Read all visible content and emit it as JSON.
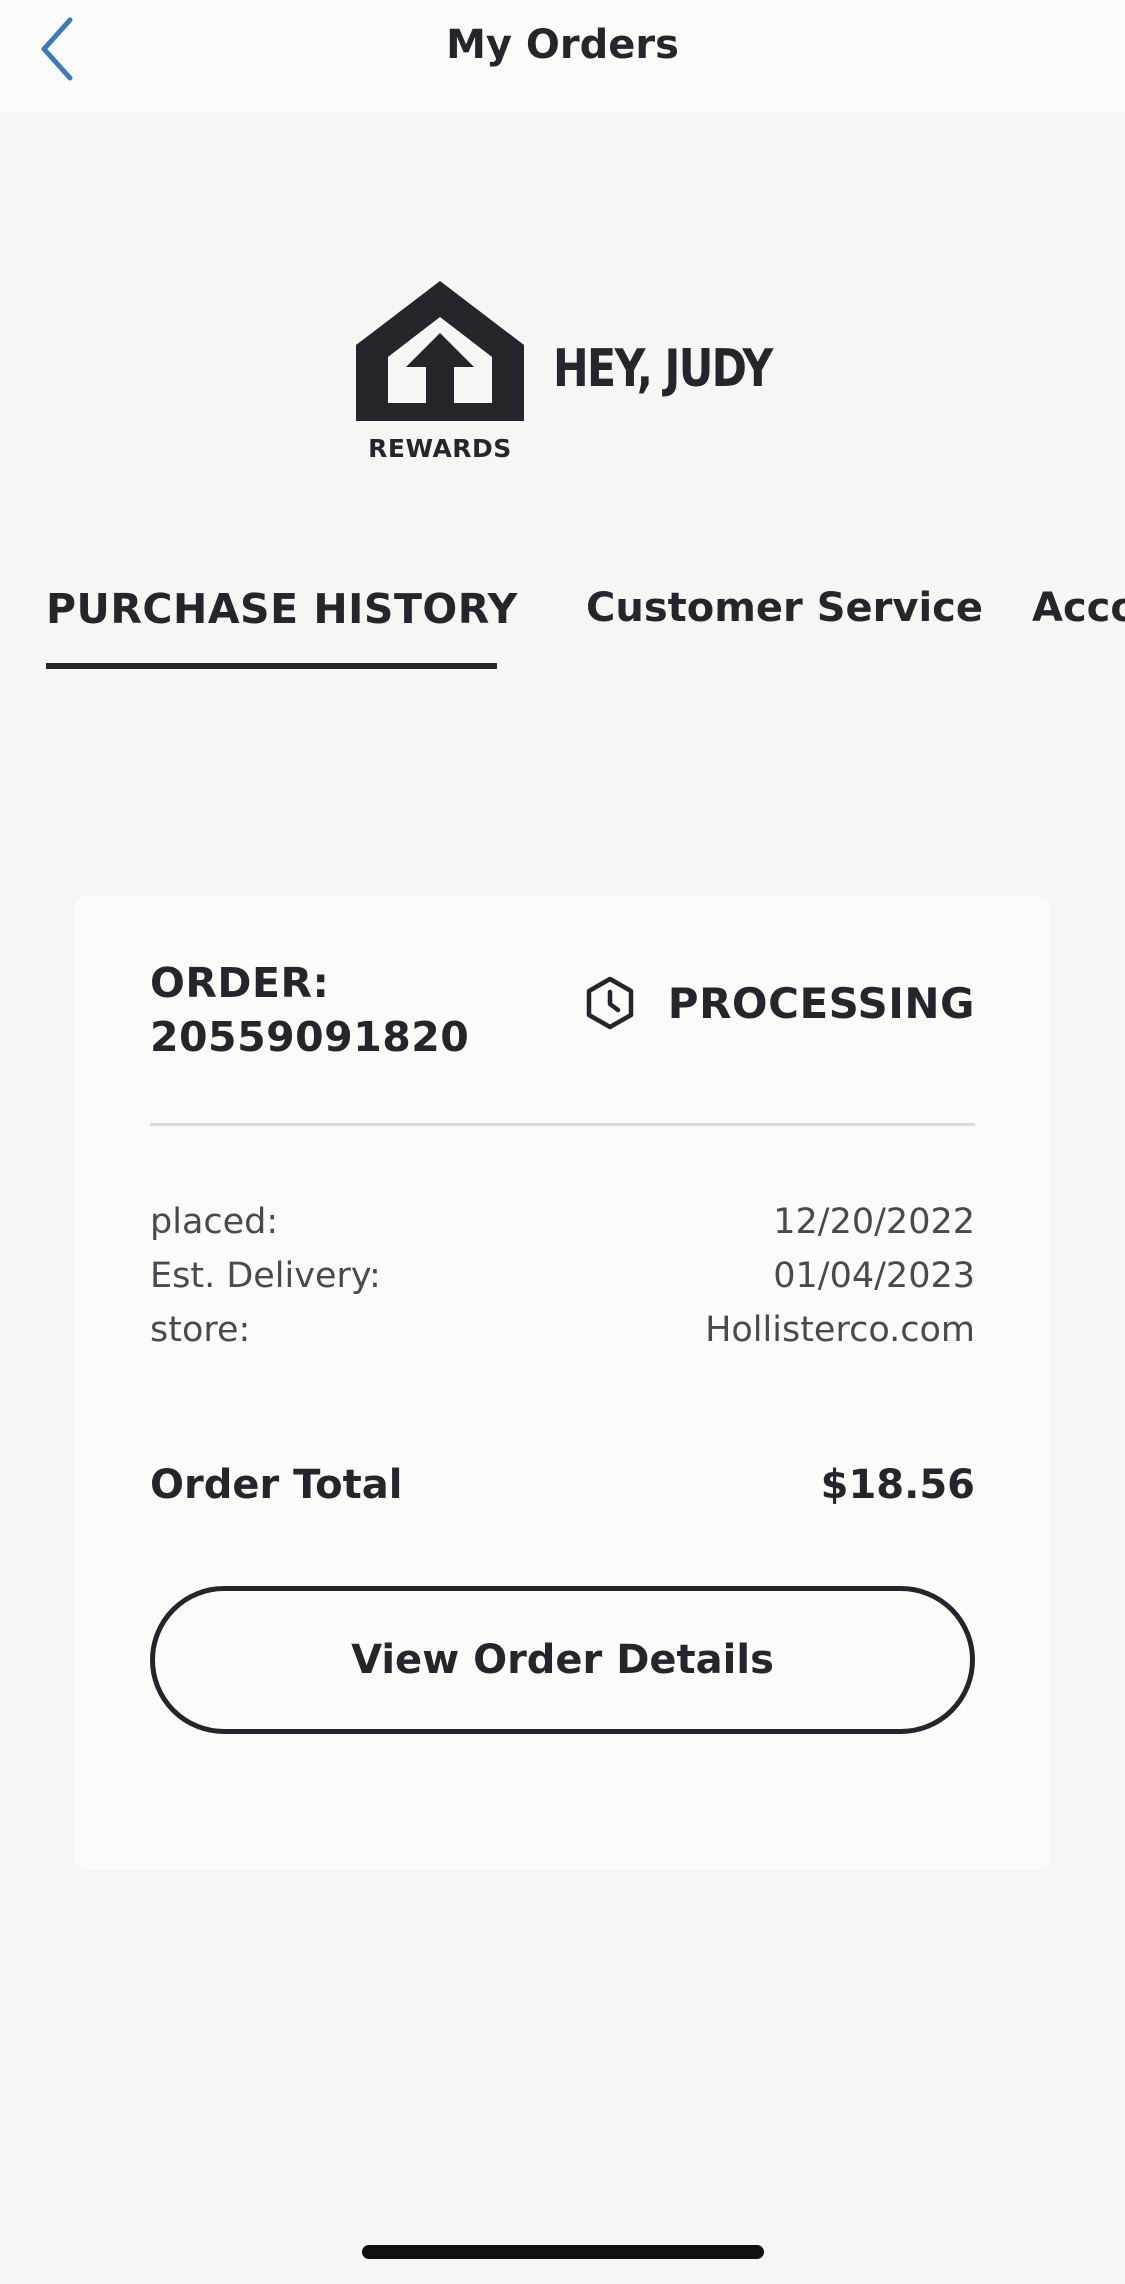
{
  "nav": {
    "title": "My Orders",
    "back_icon": "chevron-left-icon"
  },
  "header": {
    "logo_icon": "rewards-house-arrow-icon",
    "logo_text": "REWARDS",
    "greeting": "HEY, JUDY"
  },
  "tabs": [
    {
      "label": "PURCHASE HISTORY",
      "active": true
    },
    {
      "label": "Customer Service",
      "active": false
    },
    {
      "label": "Acco",
      "active": false
    }
  ],
  "order": {
    "label_line1": "ORDER:",
    "number": "20559091820",
    "status_icon": "clock-hexagon-icon",
    "status": "PROCESSING",
    "details": [
      {
        "label": "placed:",
        "value": "12/20/2022"
      },
      {
        "label": "Est. Delivery:",
        "value": "01/04/2023"
      },
      {
        "label": "store:",
        "value": "Hollisterco.com"
      }
    ],
    "total_label": "Order Total",
    "total_value": "$18.56",
    "view_button": "View Order Details"
  },
  "colors": {
    "background": "#f7f6f4",
    "card": "#fbfbfa",
    "text": "#26252b",
    "accent_back": "#3d7bb8"
  }
}
